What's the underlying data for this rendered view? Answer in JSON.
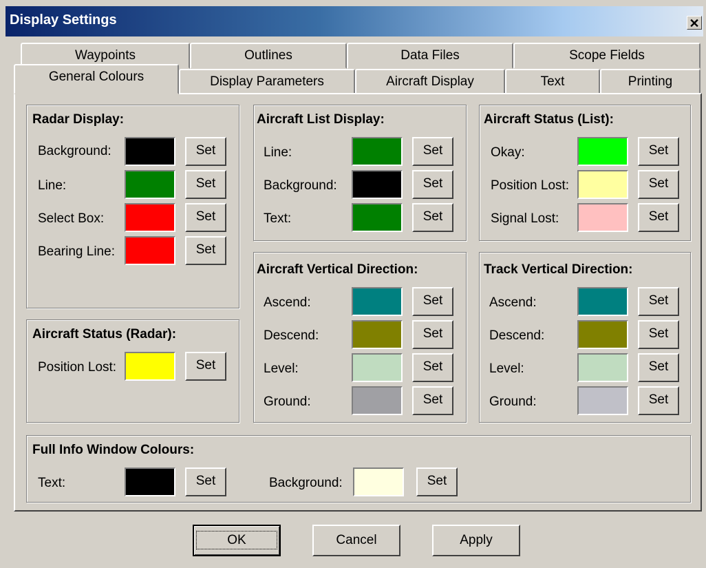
{
  "window": {
    "title": "Display Settings",
    "close_glyph": "✕"
  },
  "tabs": {
    "row1": [
      "Waypoints",
      "Outlines",
      "Data Files",
      "Scope Fields"
    ],
    "row2": [
      "General Colours",
      "Display Parameters",
      "Aircraft Display",
      "Text",
      "Printing"
    ],
    "active": "General Colours"
  },
  "set_label": "Set",
  "groups": {
    "radar_display": {
      "title": "Radar Display:",
      "items": [
        {
          "label": "Background:",
          "color": "#000000"
        },
        {
          "label": "Line:",
          "color": "#008000"
        },
        {
          "label": "Select Box:",
          "color": "#ff0000"
        },
        {
          "label": "Bearing Line:",
          "color": "#ff0000"
        }
      ]
    },
    "aircraft_status_radar": {
      "title": "Aircraft Status (Radar):",
      "items": [
        {
          "label": "Position Lost:",
          "color": "#ffff00"
        }
      ]
    },
    "aircraft_list_display": {
      "title": "Aircraft List Display:",
      "items": [
        {
          "label": "Line:",
          "color": "#008000"
        },
        {
          "label": "Background:",
          "color": "#000000"
        },
        {
          "label": "Text:",
          "color": "#008000"
        }
      ]
    },
    "aircraft_status_list": {
      "title": "Aircraft Status (List):",
      "items": [
        {
          "label": "Okay:",
          "color": "#00ff00"
        },
        {
          "label": "Position Lost:",
          "color": "#ffffa0"
        },
        {
          "label": "Signal Lost:",
          "color": "#ffc0c0"
        }
      ]
    },
    "aircraft_vertical_direction": {
      "title": "Aircraft Vertical Direction:",
      "items": [
        {
          "label": "Ascend:",
          "color": "#008080"
        },
        {
          "label": "Descend:",
          "color": "#808000"
        },
        {
          "label": "Level:",
          "color": "#c0dcc0"
        },
        {
          "label": "Ground:",
          "color": "#a0a0a4"
        }
      ]
    },
    "track_vertical_direction": {
      "title": "Track Vertical Direction:",
      "items": [
        {
          "label": "Ascend:",
          "color": "#008080"
        },
        {
          "label": "Descend:",
          "color": "#808000"
        },
        {
          "label": "Level:",
          "color": "#c0dcc0"
        },
        {
          "label": "Ground:",
          "color": "#c0c0c8"
        }
      ]
    },
    "full_info_window": {
      "title": "Full Info Window Colours:",
      "items": [
        {
          "label": "Text:",
          "color": "#000000"
        },
        {
          "label": "Background:",
          "color": "#ffffe0"
        }
      ]
    }
  },
  "buttons": {
    "ok": "OK",
    "cancel": "Cancel",
    "apply": "Apply"
  }
}
